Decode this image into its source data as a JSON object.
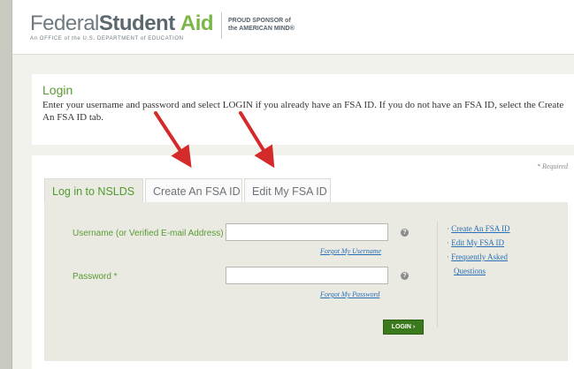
{
  "header": {
    "logo_part1": "Federal",
    "logo_part2": "Student",
    "logo_part3": "Aid",
    "logo_subtitle": "An OFFICE of the U.S. DEPARTMENT of EDUCATION",
    "sponsor_line1": "PROUD SPONSOR of",
    "sponsor_line2": "the AMERICAN MIND®"
  },
  "login_section": {
    "title": "Login",
    "instructions": "Enter your username and password and select LOGIN if you already have an FSA ID. If you do not have an FSA ID, select the Create An FSA ID tab."
  },
  "form": {
    "required_note": "* Required",
    "tabs": [
      {
        "label": "Log in to NSLDS",
        "active": true
      },
      {
        "label": "Create An FSA ID",
        "active": false
      },
      {
        "label": "Edit My FSA ID",
        "active": false
      }
    ],
    "username_label": "Username (or Verified E-mail Address) *",
    "username_value": "",
    "forgot_username": "Forgot My Username",
    "password_label": "Password *",
    "password_value": "",
    "forgot_password": "Forgot My Password",
    "login_button": "LOGIN ›",
    "help_glyph": "?"
  },
  "side_links": [
    {
      "label": "Create An FSA ID"
    },
    {
      "label": "Edit My FSA ID"
    },
    {
      "label": "Frequently Asked"
    },
    {
      "label": "Questions"
    }
  ],
  "colors": {
    "accent_green": "#5a9a34",
    "button_green": "#3a7a1d",
    "link_blue": "#2a6fb5",
    "annotation_arrow": "#d42a2a"
  },
  "icons": {
    "help": "help-circle-icon",
    "annotation": "red-arrow-icon"
  }
}
